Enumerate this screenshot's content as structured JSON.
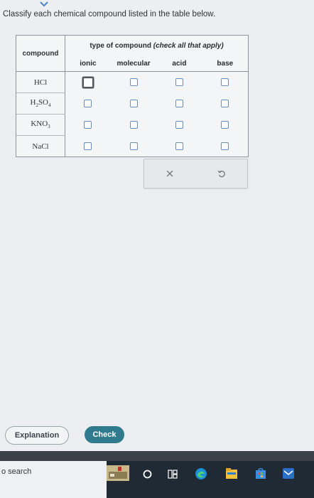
{
  "prompt": "Classify each chemical compound listed in the table below.",
  "table": {
    "compound_header": "compound",
    "type_header_prefix": "type of compound ",
    "type_header_italic": "(check all that apply)",
    "columns": [
      "ionic",
      "molecular",
      "acid",
      "base"
    ],
    "rows": [
      {
        "compound": {
          "main": "HCl",
          "parts": []
        }
      },
      {
        "compound": {
          "parts": [
            [
              "H",
              "2"
            ],
            [
              "SO",
              "4"
            ]
          ]
        }
      },
      {
        "compound": {
          "parts": [
            [
              "KNO",
              "3"
            ]
          ]
        }
      },
      {
        "compound": {
          "main": "NaCl",
          "parts": []
        }
      }
    ],
    "checked": [
      [
        false,
        false,
        false,
        false
      ],
      [
        false,
        false,
        false,
        false
      ],
      [
        false,
        false,
        false,
        false
      ],
      [
        false,
        false,
        false,
        false
      ]
    ]
  },
  "actions": {
    "clear_icon": "x-icon",
    "undo_icon": "undo-icon"
  },
  "buttons": {
    "explanation": "Explanation",
    "check": "Check"
  },
  "taskbar": {
    "search_text": "o search",
    "icons": [
      "window-thumbnail-icon",
      "cortana-circle-icon",
      "task-view-icon",
      "edge-icon",
      "file-explorer-icon",
      "store-icon",
      "mail-icon"
    ]
  },
  "colors": {
    "check_button": "#2f7a8c",
    "taskbar": "#1f2a35"
  }
}
